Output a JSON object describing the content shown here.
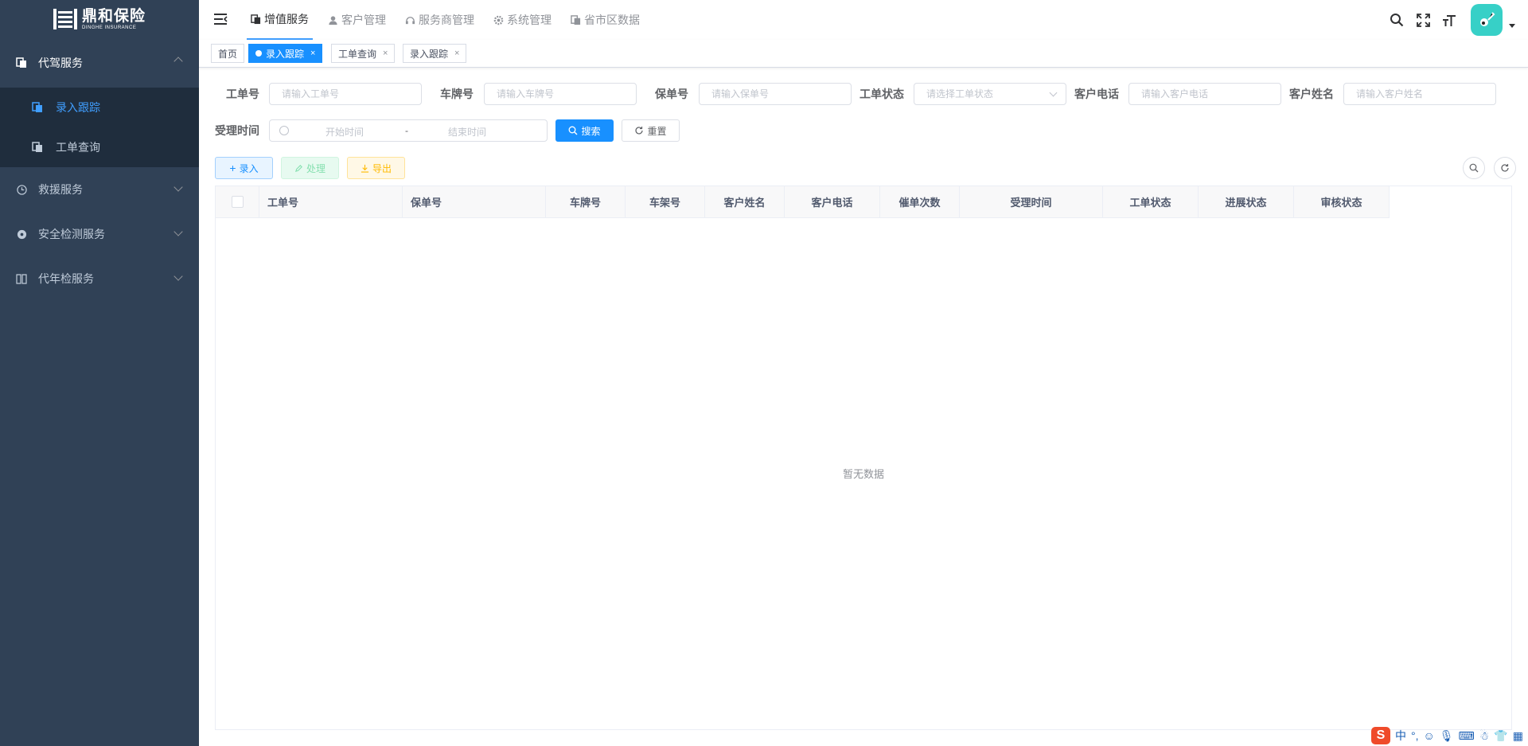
{
  "logo": {
    "cn": "鼎和保险",
    "en": "DINGHE INSURANCE"
  },
  "sidebar": {
    "items": [
      {
        "label": "代驾服务",
        "icon": "documents-icon",
        "open": true,
        "children": [
          {
            "label": "录入跟踪",
            "active": true
          },
          {
            "label": "工单查询",
            "active": false
          }
        ]
      },
      {
        "label": "救援服务",
        "icon": "clock-icon"
      },
      {
        "label": "安全检测服务",
        "icon": "settings-icon"
      },
      {
        "label": "代年检服务",
        "icon": "book-icon"
      }
    ]
  },
  "topnav": [
    {
      "label": "增值服务",
      "icon": "documents-icon",
      "active": true
    },
    {
      "label": "客户管理",
      "icon": "user-icon"
    },
    {
      "label": "服务商管理",
      "icon": "service-icon"
    },
    {
      "label": "系统管理",
      "icon": "gear-icon"
    },
    {
      "label": "省市区数据",
      "icon": "documents-icon"
    }
  ],
  "tags": [
    {
      "label": "首页"
    },
    {
      "label": "录入跟踪",
      "active": true,
      "close": "×"
    },
    {
      "label": "工单查询",
      "close": "×"
    },
    {
      "label": "录入跟踪",
      "close": "×"
    }
  ],
  "search": {
    "order_no": {
      "label": "工单号",
      "placeholder": "请输入工单号"
    },
    "plate_no": {
      "label": "车牌号",
      "placeholder": "请输入车牌号"
    },
    "policy_no": {
      "label": "保单号",
      "placeholder": "请输入保单号"
    },
    "order_status": {
      "label": "工单状态",
      "placeholder": "请选择工单状态"
    },
    "phone": {
      "label": "客户电话",
      "placeholder": "请输入客户电话"
    },
    "name": {
      "label": "客户姓名",
      "placeholder": "请输入客户姓名"
    },
    "accept_time": {
      "label": "受理时间",
      "start_placeholder": "开始时间",
      "separator": "-",
      "end_placeholder": "结束时间"
    },
    "search_button": "搜索",
    "reset_button": "重置"
  },
  "toolbar": {
    "add": "录入",
    "process": "处理",
    "export": "导出"
  },
  "table": {
    "columns": [
      "工单号",
      "保单号",
      "车牌号",
      "车架号",
      "客户姓名",
      "客户电话",
      "催单次数",
      "受理时间",
      "工单状态",
      "进展状态",
      "审核状态"
    ],
    "empty_text": "暂无数据"
  },
  "ime": {
    "logo": "S",
    "lang": "中",
    "punct": "°,"
  }
}
